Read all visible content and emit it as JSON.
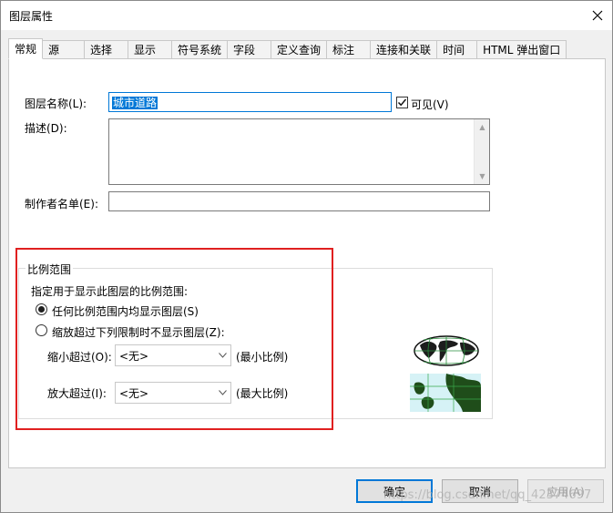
{
  "window": {
    "title": "图层属性"
  },
  "tabs": [
    {
      "label": "常规",
      "active": true
    },
    {
      "label": "源"
    },
    {
      "label": "选择"
    },
    {
      "label": "显示"
    },
    {
      "label": "符号系统"
    },
    {
      "label": "字段"
    },
    {
      "label": "定义查询"
    },
    {
      "label": "标注"
    },
    {
      "label": "连接和关联"
    },
    {
      "label": "时间"
    },
    {
      "label": "HTML 弹出窗口"
    }
  ],
  "general": {
    "layer_name_label": "图层名称(L):",
    "layer_name_value": "城市道路",
    "visible_label": "可见(V)",
    "visible_checked": true,
    "description_label": "描述(D):",
    "description_value": "",
    "author_label": "制作者名单(E):",
    "author_value": ""
  },
  "scale_range": {
    "legend": "比例范围",
    "instruction": "指定用于显示此图层的比例范围:",
    "option_all": "任何比例范围内均显示图层(S)",
    "option_limit": "缩放超过下列限制时不显示图层(Z):",
    "min_label": "缩小超过(O):",
    "min_value": "<无>",
    "min_hint": "(最小比例)",
    "max_label": "放大超过(I):",
    "max_value": "<无>",
    "max_hint": "(最大比例)"
  },
  "buttons": {
    "ok": "确定",
    "cancel": "取消",
    "apply": "应用(A)"
  },
  "watermark": "https://blog.csdn.net/qq_42374697",
  "colors": {
    "accent": "#0078d7",
    "highlight_frame": "#e02020"
  }
}
